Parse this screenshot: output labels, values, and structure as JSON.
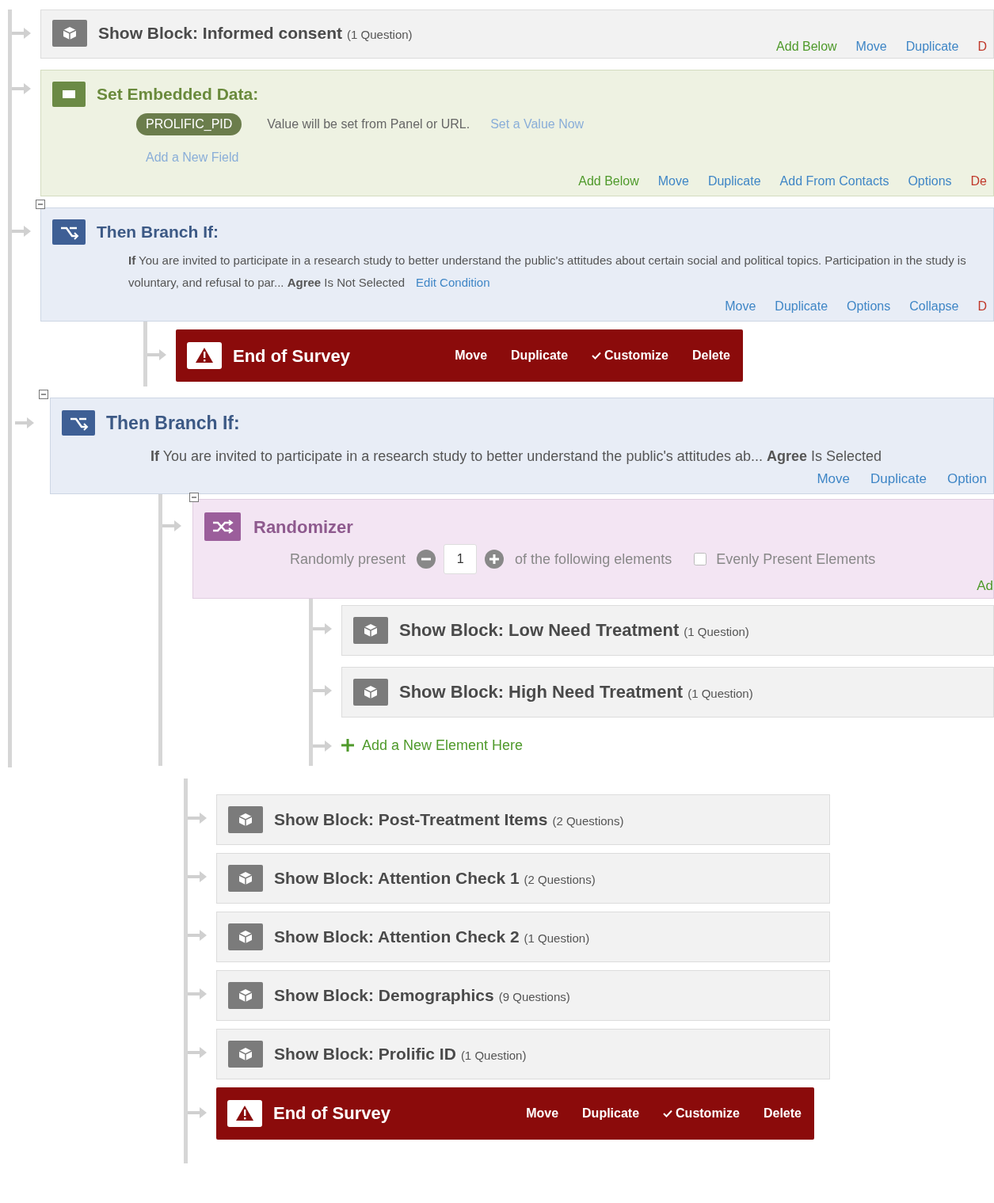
{
  "flow": [
    {
      "kind": "block",
      "title": "Show Block: Informed consent",
      "count": "(1 Question)",
      "actions": [
        {
          "label": "Add Below",
          "kind": "add"
        },
        {
          "label": "Move",
          "kind": "link"
        },
        {
          "label": "Duplicate",
          "kind": "link"
        },
        {
          "label": "D",
          "kind": "delete"
        }
      ]
    },
    {
      "kind": "embedded_data",
      "title": "Set Embedded Data:",
      "fields": [
        {
          "name": "PROLIFIC_PID",
          "note": "Value will be set from Panel or URL.",
          "link": "Set a Value Now"
        }
      ],
      "add_field": "Add a New Field",
      "actions": [
        {
          "label": "Add Below",
          "kind": "add"
        },
        {
          "label": "Move",
          "kind": "link"
        },
        {
          "label": "Duplicate",
          "kind": "link"
        },
        {
          "label": "Add From Contacts",
          "kind": "link"
        },
        {
          "label": "Options",
          "kind": "link"
        },
        {
          "label": "De",
          "kind": "delete"
        }
      ]
    },
    {
      "kind": "branch",
      "expanded": true,
      "title": "Then Branch If:",
      "condition": "**If** You are invited to participate in a research study to better understand the public's attitudes about certain social and political topics. Participation in the study is voluntary, and refusal to par... **Agree** Is Not Selected",
      "edit": "Edit Condition",
      "actions": [
        {
          "label": "Move",
          "kind": "link"
        },
        {
          "label": "Duplicate",
          "kind": "link"
        },
        {
          "label": "Options",
          "kind": "link"
        },
        {
          "label": "Collapse",
          "kind": "link"
        },
        {
          "label": "D",
          "kind": "delete"
        }
      ],
      "children": [
        {
          "kind": "end",
          "title": "End of Survey",
          "actions": [
            {
              "label": "Move",
              "kind": "plain"
            },
            {
              "label": "Duplicate",
              "kind": "plain"
            },
            {
              "label": "Customize",
              "kind": "check"
            },
            {
              "label": "Delete",
              "kind": "plain"
            }
          ]
        }
      ]
    },
    {
      "kind": "branch",
      "expanded": true,
      "title": "Then Branch If:",
      "condition": "**If** You are invited to participate in a research study to better understand the public's attitudes ab... **Agree** Is Selected",
      "actions": [
        {
          "label": "Move",
          "kind": "link"
        },
        {
          "label": "Duplicate",
          "kind": "link"
        },
        {
          "label": "Option",
          "kind": "link"
        }
      ],
      "children": [
        {
          "kind": "randomizer",
          "expanded": true,
          "title": "Randomizer",
          "lead": "Randomly present",
          "count": "1",
          "tail": "of the following elements",
          "evenly": {
            "label": "Evenly Present Elements",
            "checked": false
          },
          "actions": [
            {
              "label": "Ad",
              "kind": "add"
            }
          ],
          "children": [
            {
              "kind": "block",
              "title": "Show Block: Low Need Treatment",
              "count": "(1 Question)"
            },
            {
              "kind": "block",
              "title": "Show Block: High Need Treatment",
              "count": "(1 Question)"
            },
            {
              "kind": "add_element",
              "label": "Add a New Element Here"
            }
          ]
        }
      ]
    }
  ],
  "continued_flow": [
    {
      "kind": "block",
      "title": "Show Block: Post-Treatment Items",
      "count": "(2 Questions)"
    },
    {
      "kind": "block",
      "title": "Show Block: Attention Check 1",
      "count": "(2 Questions)"
    },
    {
      "kind": "block",
      "title": "Show Block: Attention Check 2",
      "count": "(1 Question)"
    },
    {
      "kind": "block",
      "title": "Show Block: Demographics",
      "count": "(9 Questions)"
    },
    {
      "kind": "block",
      "title": "Show Block: Prolific ID",
      "count": "(1 Question)"
    },
    {
      "kind": "end",
      "title": "End of Survey",
      "actions": [
        {
          "label": "Move",
          "kind": "plain"
        },
        {
          "label": "Duplicate",
          "kind": "plain"
        },
        {
          "label": "Customize",
          "kind": "check"
        },
        {
          "label": "Delete",
          "kind": "plain"
        }
      ]
    }
  ]
}
